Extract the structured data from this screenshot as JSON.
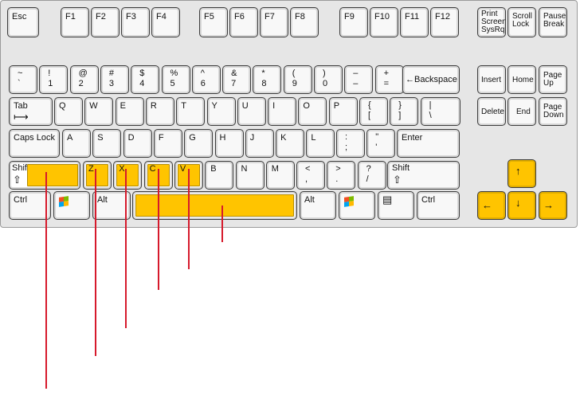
{
  "keyboard": {
    "fn_row": {
      "esc": "Esc",
      "f": [
        "F1",
        "F2",
        "F3",
        "F4",
        "F5",
        "F6",
        "F7",
        "F8",
        "F9",
        "F10",
        "F11",
        "F12"
      ],
      "print_screen": [
        "Print",
        "Screen",
        "SysRq"
      ],
      "scroll_lock": [
        "Scroll",
        "Lock"
      ],
      "pause_break": [
        "Pause",
        "Break"
      ]
    },
    "number_row": [
      {
        "top": "~",
        "bottom": "`"
      },
      {
        "top": "!",
        "bottom": "1"
      },
      {
        "top": "@",
        "bottom": "2"
      },
      {
        "top": "#",
        "bottom": "3"
      },
      {
        "top": "$",
        "bottom": "4"
      },
      {
        "top": "%",
        "bottom": "5"
      },
      {
        "top": "^",
        "bottom": "6"
      },
      {
        "top": "&",
        "bottom": "7"
      },
      {
        "top": "*",
        "bottom": "8"
      },
      {
        "top": "(",
        "bottom": "9"
      },
      {
        "top": ")",
        "bottom": "0"
      },
      {
        "top": "–",
        "bottom": "–"
      },
      {
        "top": "+",
        "bottom": "="
      }
    ],
    "backspace": "←Backspace",
    "tab": "Tab",
    "tab_arrow": "⟼",
    "qwerty_row": [
      "Q",
      "W",
      "E",
      "R",
      "T",
      "Y",
      "U",
      "I",
      "O",
      "P"
    ],
    "brackets": [
      {
        "top": "{",
        "bottom": "["
      },
      {
        "top": "}",
        "bottom": "]"
      },
      {
        "top": "|",
        "bottom": "\\"
      }
    ],
    "caps_lock": "Caps Lock",
    "home_row": [
      "A",
      "S",
      "D",
      "F",
      "G",
      "H",
      "J",
      "K",
      "L"
    ],
    "home_punct": [
      {
        "top": ":",
        "bottom": ";"
      },
      {
        "top": "\"",
        "bottom": "'"
      }
    ],
    "enter": "Enter",
    "shift": "Shift",
    "shift_arrow": "⇧",
    "bottom_letters": [
      "Z",
      "X",
      "C",
      "V",
      "B",
      "N",
      "M"
    ],
    "bottom_punct": [
      {
        "top": "<",
        "bottom": ","
      },
      {
        "top": ">",
        "bottom": "."
      },
      {
        "top": "?",
        "bottom": "/"
      }
    ],
    "ctrl": "Ctrl",
    "alt": "Alt",
    "menu_glyph": "▤",
    "nav": {
      "insert": "Insert",
      "home": "Home",
      "page_up": [
        "Page",
        "Up"
      ],
      "delete": "Delete",
      "end": "End",
      "page_down": [
        "Page",
        "Down"
      ]
    },
    "arrows": {
      "up": "↑",
      "left": "←",
      "down": "↓",
      "right": "→"
    }
  },
  "highlighted_keys": [
    "Shift",
    "Z",
    "X",
    "C",
    "V",
    "Space",
    "Up",
    "Left",
    "Down",
    "Right"
  ],
  "colors": {
    "highlight": "#ffc400",
    "pointer": "#d61a2c",
    "key_face": "#f8f8f8",
    "keyboard_body": "#e6e6e6"
  }
}
